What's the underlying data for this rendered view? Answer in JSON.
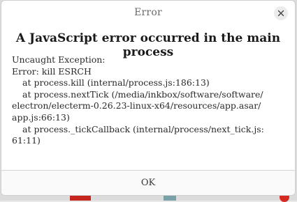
{
  "dialog": {
    "title": "Error",
    "heading": "A JavaScript error occurred in the main process",
    "message_lines": [
      "Uncaught Exception:",
      "Error: kill ESRCH",
      "at process.kill (internal/process.js:186:13)",
      "at process.nextTick (/media/inkbox/software/software/",
      "electron/electerm-0.26.23-linux-x64/resources/app.asar/",
      "app.js:66:13)",
      "at process._tickCallback (internal/process/next_tick.js:",
      "61:11)"
    ],
    "ok_label": "OK",
    "close_icon": "close-icon"
  },
  "colors": {
    "background_red": "#c5271f",
    "background_dot": "#d62a20"
  }
}
